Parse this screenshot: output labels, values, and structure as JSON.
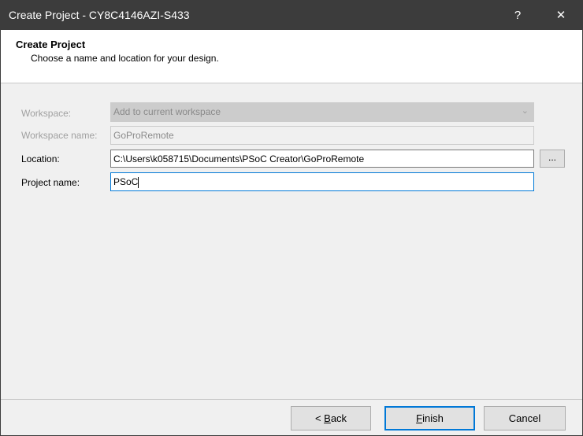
{
  "window": {
    "title": "Create Project - CY8C4146AZI-S433",
    "help": "?",
    "close": "✕"
  },
  "header": {
    "title": "Create Project",
    "subtitle": "Choose a name and location for your design."
  },
  "form": {
    "workspace_label": "Workspace:",
    "workspace_value": "Add to current workspace",
    "workspace_name_label": "Workspace name:",
    "workspace_name_value": "GoProRemote",
    "location_label": "Location:",
    "location_value": "C:\\Users\\k058715\\Documents\\PSoC Creator\\GoProRemote",
    "browse_label": "...",
    "project_name_label": "Project name:",
    "project_name_value": "PSoC"
  },
  "buttons": {
    "back_prefix": "< ",
    "back_key": "B",
    "back_rest": "ack",
    "finish_key": "F",
    "finish_rest": "inish",
    "cancel": "Cancel"
  }
}
